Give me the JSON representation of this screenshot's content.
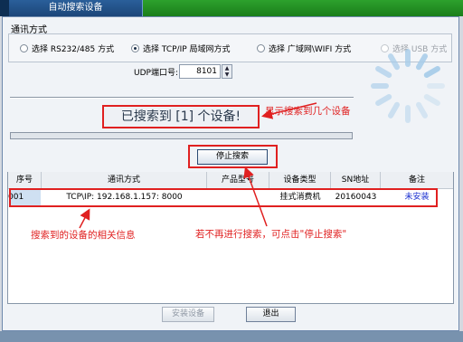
{
  "window": {
    "tab_title": "自动搜索设备"
  },
  "comm_mode": {
    "group_label": "通讯方式",
    "options": [
      {
        "label": "选择 RS232/485 方式",
        "selected": false,
        "enabled": true
      },
      {
        "label": "选择 TCP/IP 局域网方式",
        "selected": true,
        "enabled": true
      },
      {
        "label": "选择 广域网\\WIFI 方式",
        "selected": false,
        "enabled": true
      },
      {
        "label": "选择 USB 方式",
        "selected": false,
        "enabled": false
      }
    ]
  },
  "udp": {
    "label": "UDP端口号:",
    "value": "8101"
  },
  "status": {
    "text": "已搜索到 [1] 个设备!",
    "progress": 0
  },
  "buttons": {
    "stop": "停止搜索",
    "install": "安装设备",
    "exit": "退出"
  },
  "table": {
    "headers": [
      "序号",
      "通讯方式",
      "产品型号",
      "设备类型",
      "SN地址",
      "备注"
    ],
    "rows": [
      {
        "num": "001",
        "comm": "TCP\\IP: 192.168.1.157: 8000",
        "model": "",
        "type": "挂式消费机",
        "sn": "20160043",
        "note": "未安装"
      }
    ]
  },
  "annotations": {
    "count_note": "显示搜索到几个设备",
    "info_note": "搜索到的设备的相关信息",
    "stop_note": "若不再进行搜索，可点击\"停止搜索\""
  },
  "colors": {
    "accent_red": "#e02020",
    "title_green": "#2da12d",
    "link_blue": "#1a2fd0"
  }
}
